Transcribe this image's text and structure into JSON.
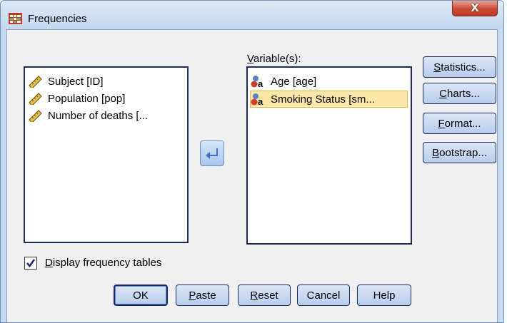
{
  "window": {
    "title": "Frequencies",
    "close_label": "X"
  },
  "source_list": {
    "items": [
      {
        "label": "Subject [ID]",
        "icon": "ruler-icon"
      },
      {
        "label": "Population [pop]",
        "icon": "ruler-icon"
      },
      {
        "label": "Number of deaths [...",
        "icon": "ruler-icon"
      }
    ]
  },
  "variables": {
    "label_prefix": "",
    "label_hotkey": "V",
    "label_rest": "ariable(s):",
    "items": [
      {
        "label": "Age [age]",
        "icon": "nominal-variable-icon",
        "selected": false
      },
      {
        "label": "Smoking Status [sm...",
        "icon": "nominal-variable-icon",
        "selected": true
      }
    ]
  },
  "side_buttons": [
    {
      "hotkey": "S",
      "rest": "tatistics...",
      "pre": ""
    },
    {
      "hotkey": "C",
      "rest": "harts...",
      "pre": ""
    },
    {
      "hotkey": "F",
      "rest": "ormat...",
      "pre": ""
    },
    {
      "hotkey": "B",
      "rest": "ootstrap...",
      "pre": ""
    }
  ],
  "checkbox": {
    "checked": true,
    "hotkey": "D",
    "rest": "isplay frequency tables"
  },
  "bottom_buttons": [
    {
      "pre": "OK",
      "hotkey": "",
      "rest": ""
    },
    {
      "pre": "",
      "hotkey": "P",
      "rest": "aste"
    },
    {
      "pre": "",
      "hotkey": "R",
      "rest": "eset"
    },
    {
      "pre": "Cancel",
      "hotkey": "",
      "rest": ""
    },
    {
      "pre": "Help",
      "hotkey": "",
      "rest": ""
    }
  ],
  "colors": {
    "accent": "#1e2a5c",
    "selection": "#fbe7a6",
    "arrow": "#3e72c4"
  }
}
